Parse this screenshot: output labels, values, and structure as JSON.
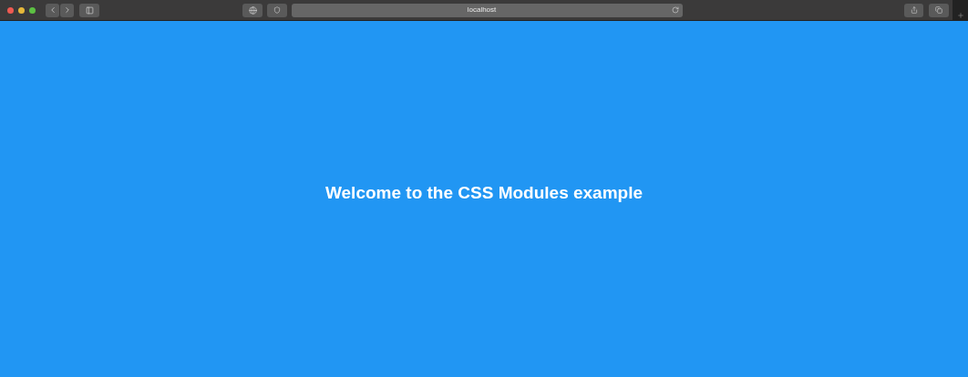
{
  "browser": {
    "address": "localhost"
  },
  "page": {
    "heading": "Welcome to the CSS Modules example"
  }
}
